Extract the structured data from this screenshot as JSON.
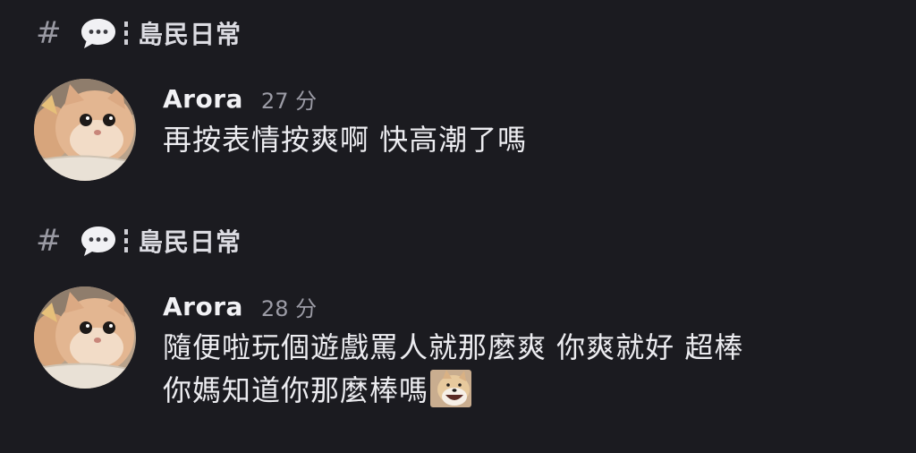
{
  "channel": {
    "hash_symbol": "#",
    "name": "島民日常",
    "icon": "speech-bubble-icon"
  },
  "messages": [
    {
      "username": "Arora",
      "timestamp": "27 分",
      "lines": [
        "再按表情按爽啊 快高潮了嗎"
      ],
      "avatar": "cat-avatar"
    },
    {
      "username": "Arora",
      "timestamp": "28 分",
      "lines": [
        "隨便啦玩個遊戲罵人就那麼爽 你爽就好 超棒",
        "你媽知道你那麼棒嗎"
      ],
      "inline_emoji": "laughing-doge-emoji",
      "avatar": "cat-avatar"
    }
  ],
  "colors": {
    "background": "#1b1b20",
    "username": "#f2f2f5",
    "timestamp": "#9c9ca6",
    "message_text": "#ececf0"
  }
}
